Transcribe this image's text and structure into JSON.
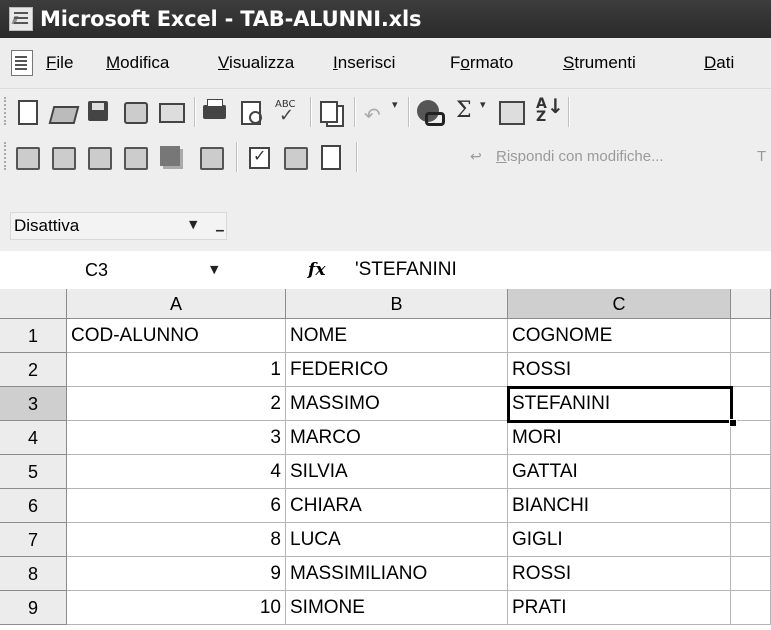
{
  "window": {
    "title": "Microsoft Excel - TAB-ALUNNI.xls"
  },
  "menu": {
    "items": [
      {
        "pre": "",
        "u": "F",
        "post": "ile"
      },
      {
        "pre": "",
        "u": "M",
        "post": "odifica"
      },
      {
        "pre": "",
        "u": "V",
        "post": "isualizza"
      },
      {
        "pre": "",
        "u": "I",
        "post": "nserisci"
      },
      {
        "pre": "F",
        "u": "o",
        "post": "rmato"
      },
      {
        "pre": "",
        "u": "S",
        "post": "trumenti"
      },
      {
        "pre": "",
        "u": "D",
        "post": "ati"
      }
    ]
  },
  "toolbar": {
    "standard_icons": [
      "new-icon",
      "open-icon",
      "save-icon",
      "permission-icon",
      "mail-icon",
      "print-icon",
      "print-preview-icon",
      "spelling-icon",
      "copy-icon",
      "undo-icon",
      "hyperlink-icon",
      "autosum-icon",
      "insert-function-icon",
      "sort-ascending-icon"
    ],
    "reviewing_icons": [
      "reviewing-icon",
      "compare-icon",
      "merge-icon",
      "edit-icon",
      "sheets-icon",
      "doc-icon",
      "track-changes-icon",
      "shared-icon",
      "reply-icon"
    ],
    "reply_u": "R",
    "reply_rest": "ispondi con modifiche...",
    "trailing": "T"
  },
  "security": {
    "value": "Disattiva"
  },
  "formula_bar": {
    "name_box": "C3",
    "fx_label": "fx",
    "formula": "'STEFANINI"
  },
  "sheet": {
    "active_cell": "C3",
    "columns": [
      "A",
      "B",
      "C"
    ],
    "rows": [
      {
        "row": "1",
        "A": "COD-ALUNNO",
        "B": "NOME",
        "C": "COGNOME"
      },
      {
        "row": "2",
        "A": "1",
        "B": "FEDERICO",
        "C": "ROSSI"
      },
      {
        "row": "3",
        "A": "2",
        "B": "MASSIMO",
        "C": "STEFANINI"
      },
      {
        "row": "4",
        "A": "3",
        "B": "MARCO",
        "C": "MORI"
      },
      {
        "row": "5",
        "A": "4",
        "B": "SILVIA",
        "C": "GATTAI"
      },
      {
        "row": "6",
        "A": "6",
        "B": "CHIARA",
        "C": "BIANCHI"
      },
      {
        "row": "7",
        "A": "8",
        "B": "LUCA",
        "C": "GIGLI"
      },
      {
        "row": "8",
        "A": "9",
        "B": "MASSIMILIANO",
        "C": "ROSSI"
      },
      {
        "row": "9",
        "A": "10",
        "B": "SIMONE",
        "C": "PRATI"
      }
    ]
  }
}
